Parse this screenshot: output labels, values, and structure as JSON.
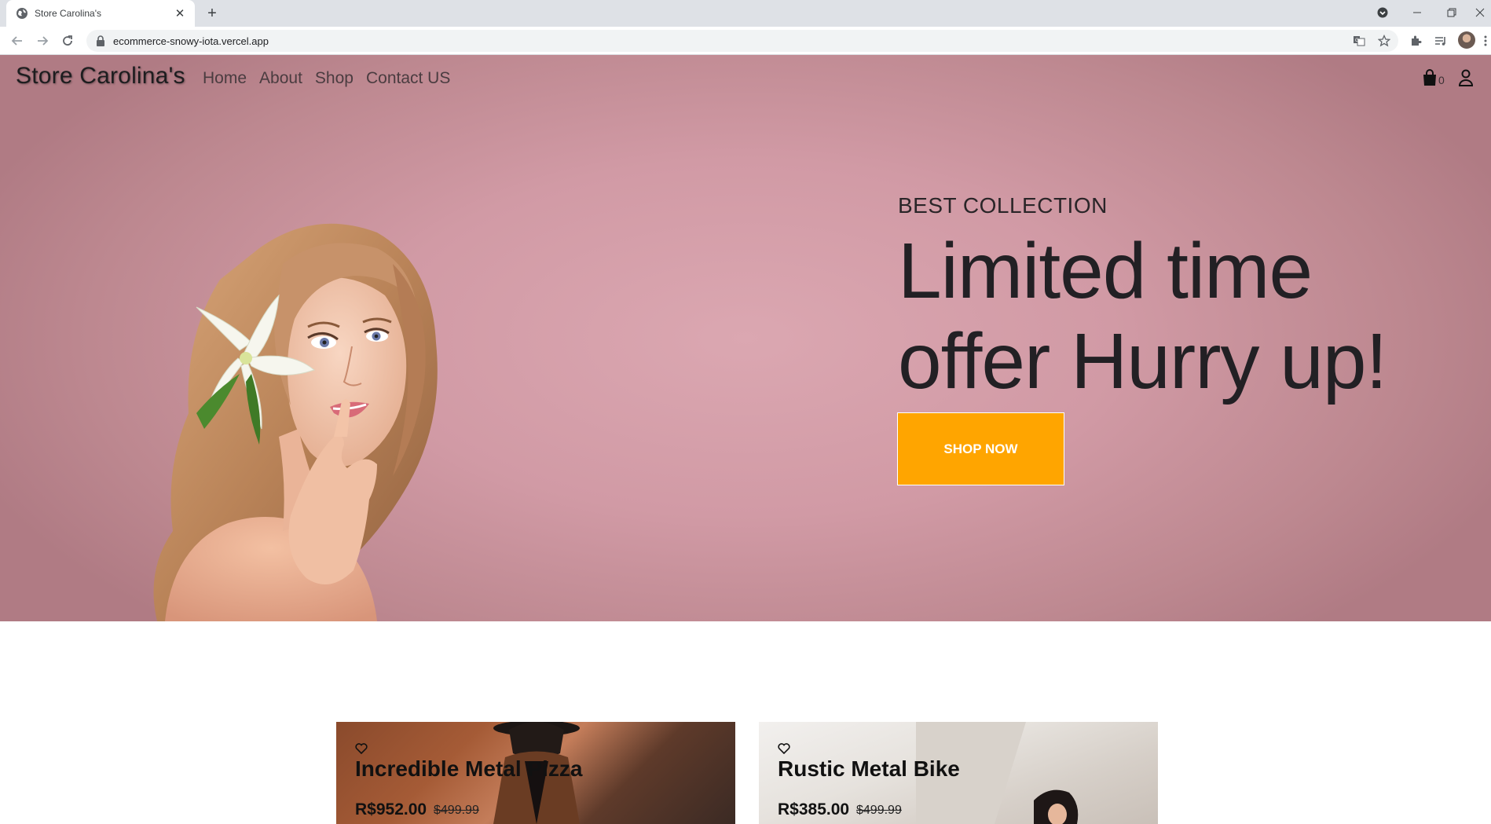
{
  "browser": {
    "tab_title": "Store Carolina's",
    "url": "ecommerce-snowy-iota.vercel.app"
  },
  "site": {
    "brand": "Store Carolina's",
    "nav": [
      "Home",
      "About",
      "Shop",
      "Contact US"
    ],
    "cart_count": "0"
  },
  "hero": {
    "subtitle": "BEST COLLECTION",
    "title_line1": "Limited time",
    "title_line2": "offer Hurry up!",
    "cta": "SHOP NOW"
  },
  "products": [
    {
      "name": "Incredible Metal Pizza",
      "price": "R$952.00",
      "old_price": "$499.99"
    },
    {
      "name": "Rustic Metal Bike",
      "price": "R$385.00",
      "old_price": "$499.99"
    }
  ],
  "colors": {
    "hero_bg": "#d19aa5",
    "cta": "#ffa500"
  }
}
